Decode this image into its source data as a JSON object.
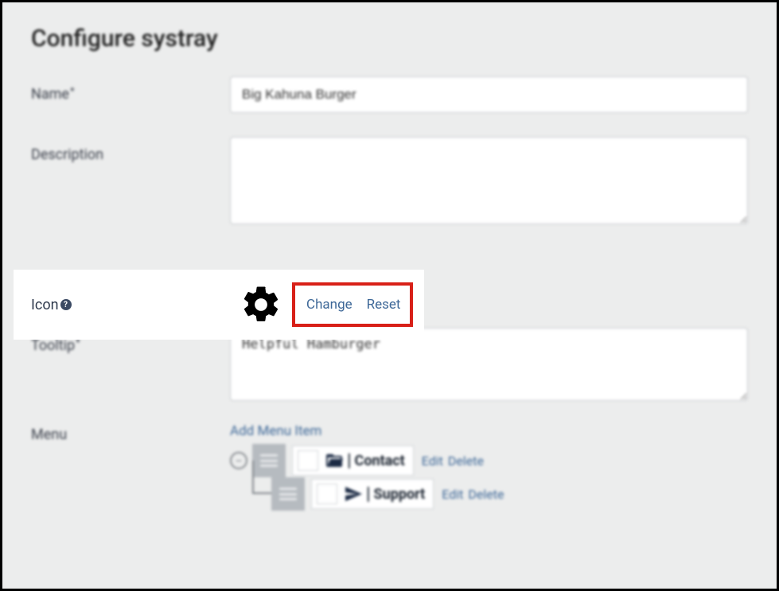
{
  "title": "Configure systray",
  "fields": {
    "name": {
      "label": "Name",
      "value": "Big Kahuna Burger"
    },
    "description": {
      "label": "Description",
      "value": ""
    },
    "icon": {
      "label": "Icon",
      "change": "Change",
      "reset": "Reset"
    },
    "tooltip": {
      "label": "Tooltip",
      "value": "Helpful Hamburger"
    },
    "menu": {
      "label": "Menu",
      "add": "Add Menu Item"
    }
  },
  "menu_items": [
    {
      "label": "Contact",
      "edit": "Edit",
      "delete": "Delete"
    },
    {
      "label": "Support",
      "edit": "Edit",
      "delete": "Delete"
    }
  ],
  "help_glyph": "?"
}
